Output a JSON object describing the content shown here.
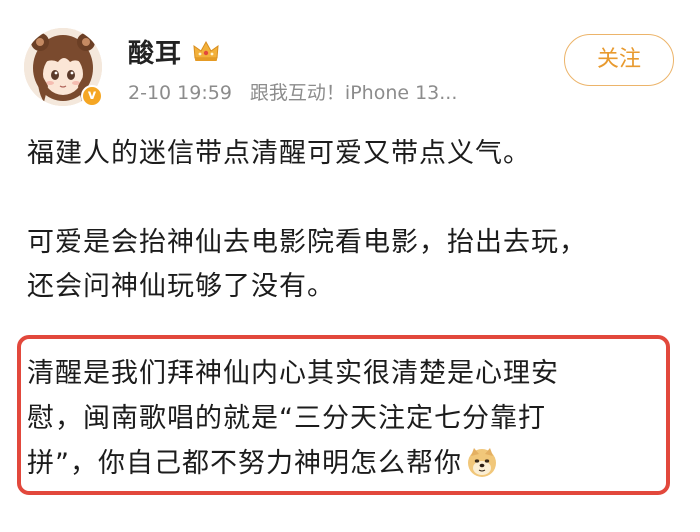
{
  "user": {
    "name": "酸耳",
    "timestamp": "2-10 19:59",
    "source": "跟我互动！iPhone 13..."
  },
  "actions": {
    "follow_label": "关注"
  },
  "post": {
    "paragraph1": "福建人的迷信带点清醒可爱又带点义气。",
    "paragraph2_line1": "可爱是会抬神仙去电影院看电影，抬出去玩，",
    "paragraph2_line2": "还会问神仙玩够了没有。",
    "paragraph3_line1": "清醒是我们拜神仙内心其实很清楚是心理安",
    "paragraph3_line2": "慰，闽南歌唱的就是“三分天注定七分靠打",
    "paragraph3_line3": "拼”，你自己都不努力神明怎么帮你"
  },
  "icons": {
    "crown": "crown-icon",
    "verified": "verified-badge-icon",
    "emoji": "doge-emoji-icon"
  },
  "colors": {
    "follow_border": "#ecb46a",
    "follow_text": "#e89a2f",
    "highlight_border": "#e2483c",
    "meta_text": "#8c8c8c"
  }
}
